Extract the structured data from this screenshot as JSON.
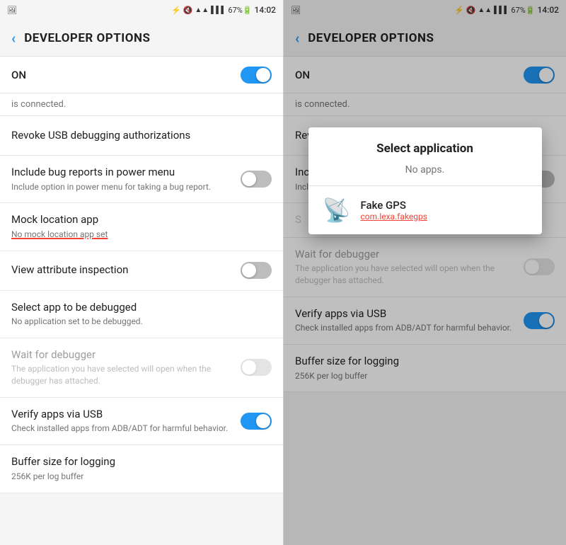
{
  "panels": [
    {
      "id": "left",
      "statusBar": {
        "left": "📷",
        "bluetooth": "⬡",
        "mute": "🔕",
        "wifi": "WiFi",
        "signal": "📶",
        "battery": "67%",
        "time": "14:02"
      },
      "header": {
        "backLabel": "‹",
        "title": "DEVELOPER OPTIONS"
      },
      "onLabel": "ON",
      "toggleOn": true,
      "connectedText": "is connected.",
      "items": [
        {
          "title": "Revoke USB debugging authorizations",
          "subtitle": null,
          "hasToggle": false,
          "toggleOn": false,
          "disabled": false,
          "redUnderline": false
        },
        {
          "title": "Include bug reports in power menu",
          "subtitle": "Include option in power menu for taking a bug report.",
          "hasToggle": true,
          "toggleOn": false,
          "disabled": false,
          "redUnderline": false
        },
        {
          "title": "Mock location app",
          "subtitle": "No mock location app set",
          "hasToggle": false,
          "toggleOn": false,
          "disabled": false,
          "redUnderline": true
        },
        {
          "title": "View attribute inspection",
          "subtitle": null,
          "hasToggle": true,
          "toggleOn": false,
          "disabled": false,
          "redUnderline": false
        },
        {
          "title": "Select app to be debugged",
          "subtitle": "No application set to be debugged.",
          "hasToggle": false,
          "toggleOn": false,
          "disabled": false,
          "redUnderline": false
        },
        {
          "title": "Wait for debugger",
          "subtitle": "The application you have selected will open when the debugger has attached.",
          "hasToggle": true,
          "toggleOn": false,
          "disabled": true,
          "redUnderline": false
        },
        {
          "title": "Verify apps via USB",
          "subtitle": "Check installed apps from ADB/ADT for harmful behavior.",
          "hasToggle": true,
          "toggleOn": true,
          "disabled": false,
          "redUnderline": false
        },
        {
          "title": "Buffer size for logging",
          "subtitle": "256K per log buffer",
          "hasToggle": false,
          "toggleOn": false,
          "disabled": false,
          "redUnderline": false
        }
      ]
    },
    {
      "id": "right",
      "statusBar": {
        "left": "📷",
        "bluetooth": "⬡",
        "mute": "🔕",
        "wifi": "WiFi",
        "signal": "📶",
        "battery": "67%",
        "time": "14:02"
      },
      "header": {
        "backLabel": "‹",
        "title": "DEVELOPER OPTIONS"
      },
      "onLabel": "ON",
      "toggleOn": true,
      "connectedText": "is connected.",
      "items": [
        {
          "title": "Revoke USB debugging authorizations",
          "subtitle": null,
          "hasToggle": false,
          "toggleOn": false,
          "disabled": false,
          "redUnderline": false
        },
        {
          "title": "Include bug reports in power menu",
          "subtitle": "Include option in power menu for taking a bug report.",
          "hasToggle": true,
          "toggleOn": false,
          "disabled": false,
          "redUnderline": false
        },
        {
          "title": "Wait for debugger",
          "subtitle": "The application you have selected will open when the debugger has attached.",
          "hasToggle": true,
          "toggleOn": false,
          "disabled": true,
          "redUnderline": false
        },
        {
          "title": "Verify apps via USB",
          "subtitle": "Check installed apps from ADB/ADT for harmful behavior.",
          "hasToggle": true,
          "toggleOn": true,
          "disabled": false,
          "redUnderline": false
        },
        {
          "title": "Buffer size for logging",
          "subtitle": "256K per log buffer",
          "hasToggle": false,
          "toggleOn": false,
          "disabled": false,
          "redUnderline": false
        }
      ],
      "dialog": {
        "title": "Select application",
        "noAppsText": "No apps.",
        "apps": [
          {
            "name": "Fake GPS",
            "package": "com.lexa.fakegps",
            "icon": "🎯"
          }
        ]
      }
    }
  ]
}
